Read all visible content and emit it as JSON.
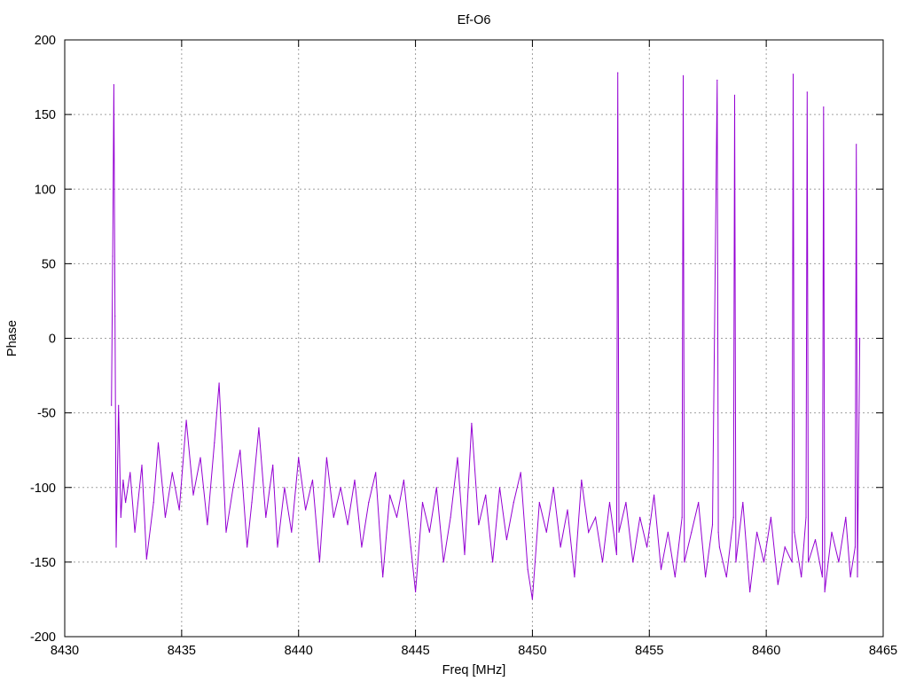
{
  "chart_data": {
    "type": "line",
    "title": "Ef-O6",
    "xlabel": "Freq [MHz]",
    "ylabel": "Phase",
    "xlim": [
      8430,
      8465
    ],
    "ylim": [
      -200,
      200
    ],
    "xticks": [
      8430,
      8435,
      8440,
      8445,
      8450,
      8455,
      8460,
      8465
    ],
    "yticks": [
      -200,
      -150,
      -100,
      -50,
      0,
      50,
      100,
      150,
      200
    ],
    "grid": true,
    "legend": "none",
    "series": [
      {
        "color": "#9400d3",
        "x": [
          8432.0,
          8432.05,
          8432.1,
          8432.15,
          8432.2,
          8432.3,
          8432.4,
          8432.5,
          8432.6,
          8432.8,
          8433.0,
          8433.3,
          8433.5,
          8433.8,
          8434.0,
          8434.3,
          8434.6,
          8434.9,
          8435.2,
          8435.5,
          8435.8,
          8436.1,
          8436.4,
          8436.6,
          8436.9,
          8437.2,
          8437.5,
          8437.8,
          8438.0,
          8438.3,
          8438.6,
          8438.9,
          8439.1,
          8439.4,
          8439.7,
          8440.0,
          8440.3,
          8440.6,
          8440.9,
          8441.2,
          8441.5,
          8441.8,
          8442.1,
          8442.4,
          8442.7,
          8443.0,
          8443.3,
          8443.6,
          8443.9,
          8444.2,
          8444.5,
          8444.8,
          8445.0,
          8445.3,
          8445.6,
          8445.9,
          8446.2,
          8446.5,
          8446.8,
          8447.1,
          8447.4,
          8447.7,
          8448.0,
          8448.3,
          8448.6,
          8448.9,
          8449.2,
          8449.5,
          8449.8,
          8450.0,
          8450.3,
          8450.6,
          8450.9,
          8451.2,
          8451.5,
          8451.8,
          8452.1,
          8452.4,
          8452.7,
          8453.0,
          8453.3,
          8453.6,
          8453.65,
          8453.7,
          8454.0,
          8454.3,
          8454.6,
          8454.9,
          8455.2,
          8455.5,
          8455.8,
          8456.1,
          8456.4,
          8456.45,
          8456.5,
          8456.8,
          8457.1,
          8457.4,
          8457.7,
          8457.9,
          8457.95,
          8458.0,
          8458.3,
          8458.6,
          8458.65,
          8458.7,
          8459.0,
          8459.3,
          8459.6,
          8459.9,
          8460.2,
          8460.5,
          8460.8,
          8461.1,
          8461.15,
          8461.2,
          8461.5,
          8461.7,
          8461.75,
          8461.8,
          8462.1,
          8462.4,
          8462.45,
          8462.5,
          8462.8,
          8463.1,
          8463.4,
          8463.6,
          8463.8,
          8463.85,
          8463.9,
          8464.0
        ],
        "y": [
          -45,
          55,
          170,
          15,
          -140,
          -45,
          -120,
          -95,
          -110,
          -90,
          -130,
          -85,
          -148,
          -110,
          -70,
          -120,
          -90,
          -115,
          -55,
          -105,
          -80,
          -125,
          -70,
          -30,
          -130,
          -100,
          -75,
          -140,
          -110,
          -60,
          -120,
          -85,
          -140,
          -100,
          -130,
          -80,
          -115,
          -95,
          -150,
          -80,
          -120,
          -100,
          -125,
          -95,
          -140,
          -110,
          -90,
          -160,
          -105,
          -120,
          -95,
          -140,
          -170,
          -110,
          -130,
          -100,
          -150,
          -120,
          -80,
          -145,
          -57,
          -125,
          -105,
          -150,
          -100,
          -135,
          -110,
          -90,
          -155,
          -175,
          -110,
          -130,
          -100,
          -140,
          -115,
          -160,
          -95,
          -130,
          -120,
          -150,
          -110,
          -145,
          178,
          -130,
          -110,
          -150,
          -120,
          -140,
          -105,
          -155,
          -130,
          -160,
          -120,
          176,
          -150,
          -130,
          -110,
          -160,
          -125,
          173,
          -130,
          -140,
          -160,
          -120,
          163,
          -150,
          -110,
          -170,
          -130,
          -150,
          -120,
          -165,
          -140,
          -150,
          177,
          -130,
          -160,
          -120,
          165,
          -150,
          -135,
          -160,
          155,
          -170,
          -130,
          -150,
          -120,
          -160,
          -140,
          130,
          -160,
          0
        ]
      }
    ]
  }
}
